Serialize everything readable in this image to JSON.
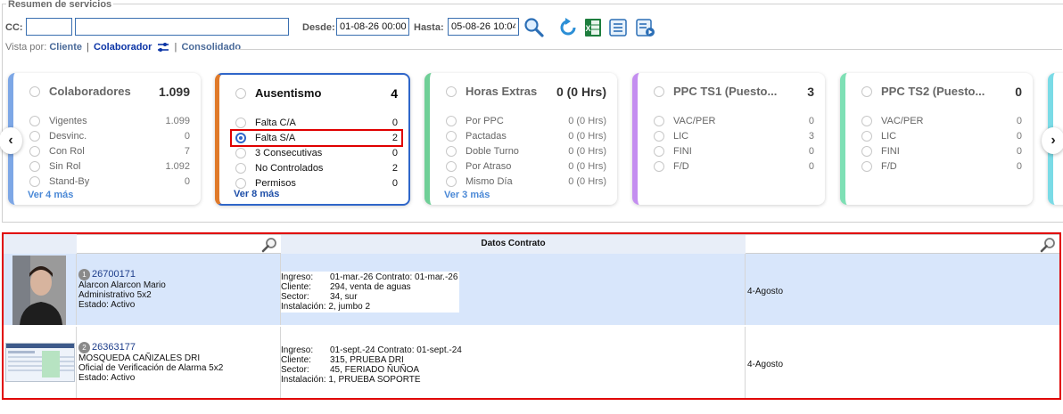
{
  "summary": {
    "legend": "Resumen de servicios",
    "cc_label": "CC:",
    "cc_value": "",
    "cc_name_value": "",
    "desde_label": "Desde:",
    "desde_value": "01-08-26 00:00",
    "hasta_label": "Hasta:",
    "hasta_value": "05-08-26 10:04"
  },
  "vista": {
    "label": "Vista por:",
    "options": [
      "Cliente",
      "Colaborador",
      "Consolidado"
    ],
    "separator": "|"
  },
  "cards": [
    {
      "title": "Colaboradores",
      "total": "1.099",
      "accent": "#7da7e6",
      "items": [
        {
          "name": "Vigentes",
          "value": "1.099"
        },
        {
          "name": "Desvinc.",
          "value": "0"
        },
        {
          "name": "Con Rol",
          "value": "7"
        },
        {
          "name": "Sin Rol",
          "value": "1.092"
        },
        {
          "name": "Stand-By",
          "value": "0"
        }
      ],
      "more": "Ver 4 más"
    },
    {
      "title": "Ausentismo",
      "total": "4",
      "accent": "#e07a2a",
      "items": [
        {
          "name": "Falta C/A",
          "value": "0"
        },
        {
          "name": "Falta S/A",
          "value": "2"
        },
        {
          "name": "3 Consecutivas",
          "value": "0"
        },
        {
          "name": "No Controlados",
          "value": "2"
        },
        {
          "name": "Permisos",
          "value": "0"
        }
      ],
      "more": "Ver 8 más"
    },
    {
      "title": "Horas Extras",
      "total": "0 (0 Hrs)",
      "accent": "#6fcf97",
      "items": [
        {
          "name": "Por PPC",
          "value": "0 (0 Hrs)"
        },
        {
          "name": "Pactadas",
          "value": "0 (0 Hrs)"
        },
        {
          "name": "Doble Turno",
          "value": "0 (0 Hrs)"
        },
        {
          "name": "Por Atraso",
          "value": "0 (0 Hrs)"
        },
        {
          "name": "Mismo Día",
          "value": "0 (0 Hrs)"
        }
      ],
      "more": "Ver 3 más"
    },
    {
      "title": "PPC TS1 (Puesto...",
      "total": "3",
      "accent": "#c48ef0",
      "items": [
        {
          "name": "VAC/PER",
          "value": "0"
        },
        {
          "name": "LIC",
          "value": "3"
        },
        {
          "name": "FINI",
          "value": "0"
        },
        {
          "name": "F/D",
          "value": "0"
        }
      ],
      "more": ""
    },
    {
      "title": "PPC TS2 (Puesto...",
      "total": "0",
      "accent": "#7ee0b5",
      "items": [
        {
          "name": "VAC/PER",
          "value": "0"
        },
        {
          "name": "LIC",
          "value": "0"
        },
        {
          "name": "FINI",
          "value": "0"
        },
        {
          "name": "F/D",
          "value": "0"
        }
      ],
      "more": ""
    }
  ],
  "nav": {
    "prev": "‹",
    "next": "›"
  },
  "grid": {
    "header_mid": "Datos Contrato",
    "rows": [
      {
        "badge": "1",
        "code": "26700171",
        "name": "Alarcon Alarcon Mario",
        "role": "Administrativo 5x2",
        "status": "Estado: Activo",
        "ingreso_k": "Ingreso:",
        "ingreso_v": "01-mar.-26 Contrato: 01-mar.-26",
        "cliente_k": "Cliente:",
        "cliente_v": "294, venta de aguas",
        "sector_k": "Sector:",
        "sector_v": "34, sur",
        "instalacion": "Instalación: 2, jumbo 2",
        "date": "4-Agosto"
      },
      {
        "badge": "2",
        "code": "26363177",
        "name": "MOSQUEDA CAÑIZALES DRI",
        "role": "Oficial de Verificación de Alarma 5x2",
        "status": "Estado: Activo",
        "ingreso_k": "Ingreso:",
        "ingreso_v": "01-sept.-24 Contrato: 01-sept.-24",
        "cliente_k": "Cliente:",
        "cliente_v": "315, PRUEBA DRI",
        "sector_k": "Sector:",
        "sector_v": "45, FERIADO ÑUÑOA",
        "instalacion": "Instalación: 1, PRUEBA SOPORTE",
        "date": "4-Agosto"
      }
    ]
  }
}
